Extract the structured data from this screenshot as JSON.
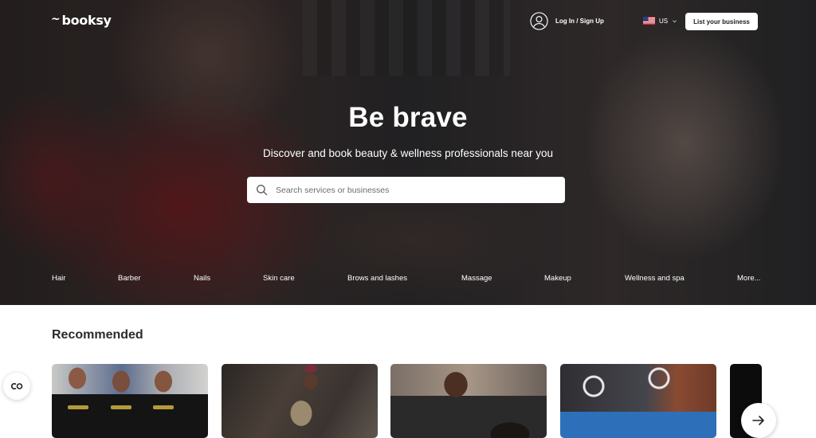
{
  "brand": {
    "name": "booksy"
  },
  "header": {
    "login_label": "Log In / Sign Up",
    "locale_label": "US",
    "list_business_label": "List your business"
  },
  "hero": {
    "headline": "Be brave",
    "subheadline": "Discover and book beauty & wellness professionals near you",
    "search": {
      "placeholder": "Search services or businesses",
      "value": ""
    },
    "categories": [
      "Hair",
      "Barber",
      "Nails",
      "Skin care",
      "Brows and lashes",
      "Massage",
      "Makeup",
      "Wellness and spa",
      "More..."
    ]
  },
  "recommended": {
    "title": "Recommended"
  },
  "icons": {
    "user": "user-circle-icon",
    "flag": "us-flag-icon",
    "chevron": "chevron-down-icon",
    "search": "search-icon",
    "next": "arrow-right-icon",
    "accessibility": "accessibility-icon"
  }
}
